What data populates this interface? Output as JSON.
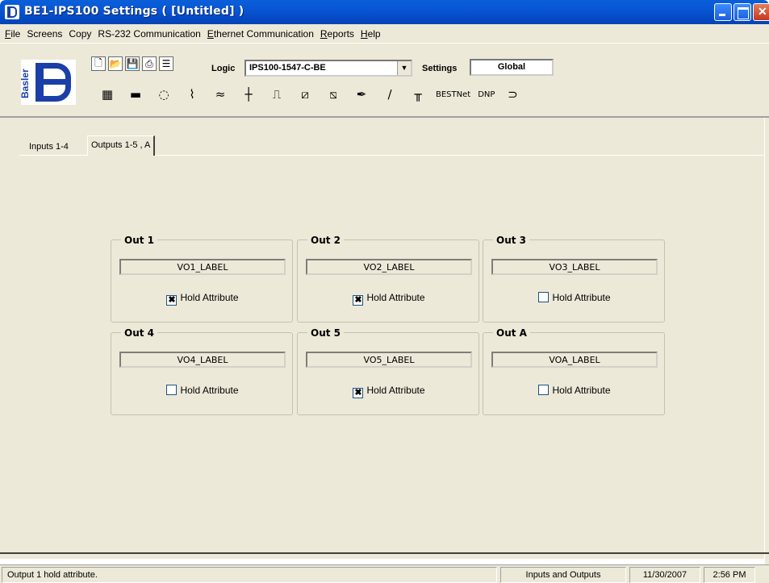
{
  "window": {
    "title": "BE1-IPS100 Settings    ( [Untitled] )"
  },
  "menu": [
    {
      "label": "File"
    },
    {
      "label": "Screens"
    },
    {
      "label": "Copy"
    },
    {
      "label": "RS-232 Communication"
    },
    {
      "label": "Ethernet Communication"
    },
    {
      "label": "Reports"
    },
    {
      "label": "Help"
    }
  ],
  "toolbar": {
    "logo_text": "Basler",
    "logic_label": "Logic",
    "logic_value": "IPS100-1547-C-BE",
    "settings_label": "Settings",
    "settings_value": "Global",
    "icons": [
      "new-icon",
      "open-icon",
      "save-icon",
      "print-icon",
      "properties-icon"
    ],
    "bestnet_label": "BESTNet",
    "dnp_label": "DNP"
  },
  "tabs": [
    {
      "label": "Inputs 1-4"
    },
    {
      "label": "Outputs 1-5 , A",
      "selected": true
    }
  ],
  "outputs": [
    {
      "title": "Out 1",
      "label": "VO1_LABEL",
      "hold_text": "Hold Attribute",
      "hold": true,
      "hold_mark": "✖"
    },
    {
      "title": "Out 2",
      "label": "VO2_LABEL",
      "hold_text": "Hold Attribute",
      "hold": true,
      "hold_mark": "✖"
    },
    {
      "title": "Out 3",
      "label": "VO3_LABEL",
      "hold_text": "Hold Attribute",
      "hold": false,
      "hold_mark": ""
    },
    {
      "title": "Out 4",
      "label": "VO4_LABEL",
      "hold_text": "Hold Attribute",
      "hold": false,
      "hold_mark": ""
    },
    {
      "title": "Out 5",
      "label": "VO5_LABEL",
      "hold_text": "Hold Attribute",
      "hold": true,
      "hold_mark": "✖"
    },
    {
      "title": "Out A",
      "label": "VOA_LABEL",
      "hold_text": "Hold Attribute",
      "hold": false,
      "hold_mark": ""
    }
  ],
  "status": {
    "message": "Output 1 hold attribute.",
    "screen": "Inputs and Outputs",
    "date": "11/30/2007",
    "time": "2:56 PM"
  }
}
